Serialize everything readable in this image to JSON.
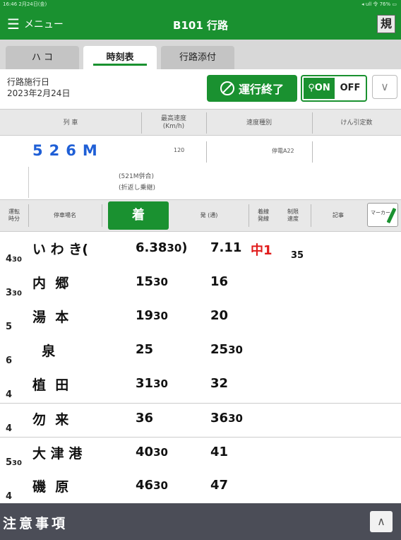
{
  "status": {
    "left": "16:46 2月24日(金)",
    "right": "◂ ull 令 76% ▭"
  },
  "header": {
    "menu_label": "メニュー",
    "title": "B101 行路",
    "kisei_label": "規"
  },
  "tabs": [
    {
      "label": "ハ コ",
      "active": false
    },
    {
      "label": "時刻表",
      "active": true
    },
    {
      "label": "行路添付",
      "active": false
    }
  ],
  "operation": {
    "date_label": "行路施行日",
    "date_value": "2023年2月24日",
    "end_label": "運行終了",
    "toggle_on": "ON",
    "toggle_off": "OFF"
  },
  "info": {
    "headers": [
      "列 車",
      "最高速度\n(Km/h)",
      "速度種別",
      "けん引定数"
    ],
    "train_number": "526M",
    "max_speed": "120",
    "speed_type": "停電A22",
    "note_line1": "(521M併合)",
    "note_line2": "(折返し乗継)"
  },
  "columns": {
    "runtime": "運転\n時分",
    "station": "停車場名",
    "arrival": "着",
    "departure": "発 (通)",
    "track": "着線\n発線",
    "limit": "制限\n速度",
    "remarks": "記事",
    "marker": "マーカー"
  },
  "rows": [
    {
      "runtime": "4",
      "runtime_sub": "30",
      "station": "い わ き(",
      "arr": "6.38",
      "arr_sub": "30",
      "arr_suffix": ")",
      "dep": "7.11",
      "dep_sub": "",
      "note_red": "中1",
      "note_num": "35"
    },
    {
      "runtime": "3",
      "runtime_sub": "30",
      "station": "内  郷",
      "arr": "15",
      "arr_sub": "30",
      "arr_suffix": "",
      "dep": "16",
      "dep_sub": "",
      "note_red": "",
      "note_num": ""
    },
    {
      "runtime": "5",
      "runtime_sub": "",
      "station": "湯  本",
      "arr": "19",
      "arr_sub": "30",
      "arr_suffix": "",
      "dep": "20",
      "dep_sub": "",
      "note_red": "",
      "note_num": ""
    },
    {
      "runtime": "6",
      "runtime_sub": "",
      "station": "  泉",
      "arr": "25",
      "arr_sub": "",
      "arr_suffix": "",
      "dep": "25",
      "dep_sub": "30",
      "note_red": "",
      "note_num": ""
    },
    {
      "runtime": "4",
      "runtime_sub": "",
      "station": "植  田",
      "arr": "31",
      "arr_sub": "30",
      "arr_suffix": "",
      "dep": "32",
      "dep_sub": "",
      "note_red": "",
      "note_num": ""
    },
    {
      "runtime": "4",
      "runtime_sub": "",
      "station": "勿  来",
      "arr": "36",
      "arr_sub": "",
      "arr_suffix": "",
      "dep": "36",
      "dep_sub": "30",
      "note_red": "",
      "note_num": ""
    },
    {
      "runtime": "5",
      "runtime_sub": "30",
      "station": "大 津 港",
      "arr": "40",
      "arr_sub": "30",
      "arr_suffix": "",
      "dep": "41",
      "dep_sub": "",
      "note_red": "",
      "note_num": ""
    },
    {
      "runtime": "4",
      "runtime_sub": "",
      "station": "磯  原",
      "arr": "46",
      "arr_sub": "30",
      "arr_suffix": "",
      "dep": "47",
      "dep_sub": "",
      "note_red": "",
      "note_num": ""
    }
  ],
  "footer": {
    "title": "注意事項"
  },
  "colors": {
    "green": "#1a9130",
    "blue": "#1f5fd6",
    "red": "#e11b1b",
    "footer": "#4b4d57"
  },
  "icons": {
    "menu": "hamburger-icon",
    "end": "cancel-circle-icon",
    "location": "location-pin-icon",
    "chevron": "chevron-down-icon",
    "pen": "pen-icon",
    "up": "chevron-up-icon"
  }
}
